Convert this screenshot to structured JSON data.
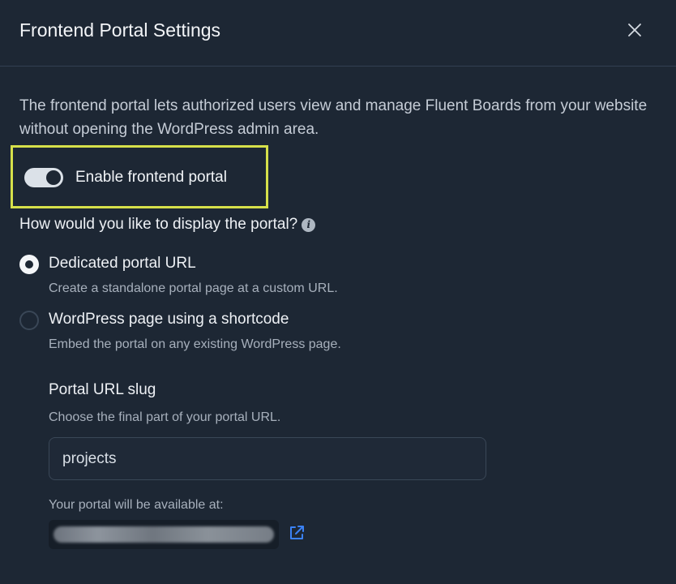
{
  "dialog": {
    "title": "Frontend Portal Settings",
    "close_icon": "close-icon"
  },
  "description": "The frontend portal lets authorized users view and manage Fluent Boards from your website without opening the WordPress admin area.",
  "toggle": {
    "label": "Enable frontend portal",
    "enabled": true
  },
  "display": {
    "question": "How would you like to display the portal?",
    "info_icon": "info-icon",
    "options": [
      {
        "label": "Dedicated portal URL",
        "help": "Create a standalone portal page at a custom URL.",
        "selected": true
      },
      {
        "label": "WordPress page using a shortcode",
        "help": "Embed the portal on any existing WordPress page.",
        "selected": false
      }
    ]
  },
  "slug": {
    "title": "Portal URL slug",
    "help": "Choose the final part of your portal URL.",
    "value": "projects"
  },
  "availability": {
    "label": "Your portal will be available at:",
    "external_link_icon": "external-link-icon"
  },
  "colors": {
    "background": "#1d2734",
    "highlight_border": "#d6e04a",
    "link_accent": "#3b82f6"
  }
}
